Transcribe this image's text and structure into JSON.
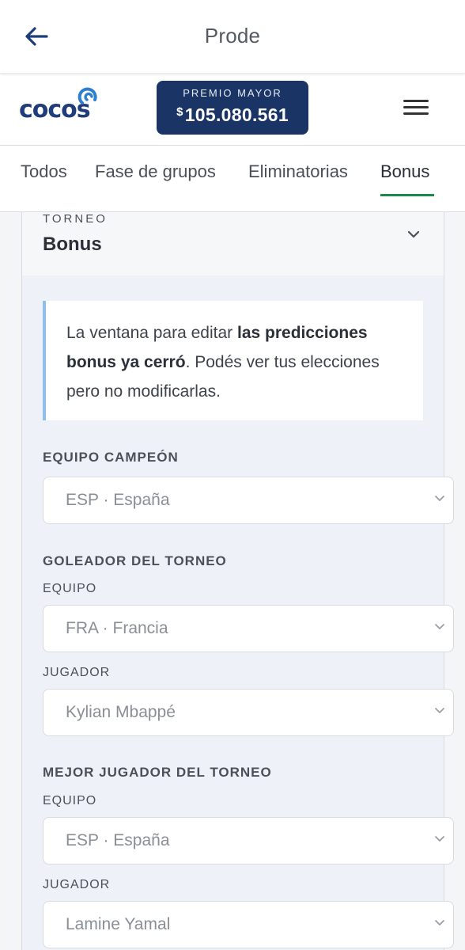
{
  "appbar": {
    "title": "Prode"
  },
  "brand": {
    "logo_text": "cocos"
  },
  "prize": {
    "label": "PREMIO MAYOR",
    "currency": "$",
    "amount": "105.080.561"
  },
  "tabs": [
    {
      "label": "Todos"
    },
    {
      "label": "Fase de grupos"
    },
    {
      "label": "Eliminatorias"
    },
    {
      "label": "Bonus",
      "active": true
    }
  ],
  "tournament": {
    "label": "TORNEO",
    "title": "Bonus"
  },
  "notice": {
    "text_before": "La ventana para editar ",
    "bold": "las predicciones bonus ya cerró",
    "text_after": ". Podés ver tus elecciones pero no modificarlas."
  },
  "champion": {
    "section": "EQUIPO CAMPEÓN",
    "value": "ESP · España"
  },
  "top_scorer": {
    "section": "GOLEADOR DEL TORNEO",
    "team_label": "EQUIPO",
    "team_value": "FRA · Francia",
    "player_label": "JUGADOR",
    "player_value": "Kylian Mbappé"
  },
  "best_player": {
    "section": "MEJOR JUGADOR DEL TORNEO",
    "team_label": "EQUIPO",
    "team_value": "ESP · España",
    "player_label": "JUGADOR",
    "player_value": "Lamine Yamal"
  },
  "colors": {
    "brand_blue": "#1a3466",
    "tab_active": "#1a8a4a",
    "notice_border": "#8fbfe8"
  },
  "icons": {
    "back": "arrow-left-icon",
    "menu": "hamburger-icon",
    "chevron": "chevron-down-icon"
  }
}
